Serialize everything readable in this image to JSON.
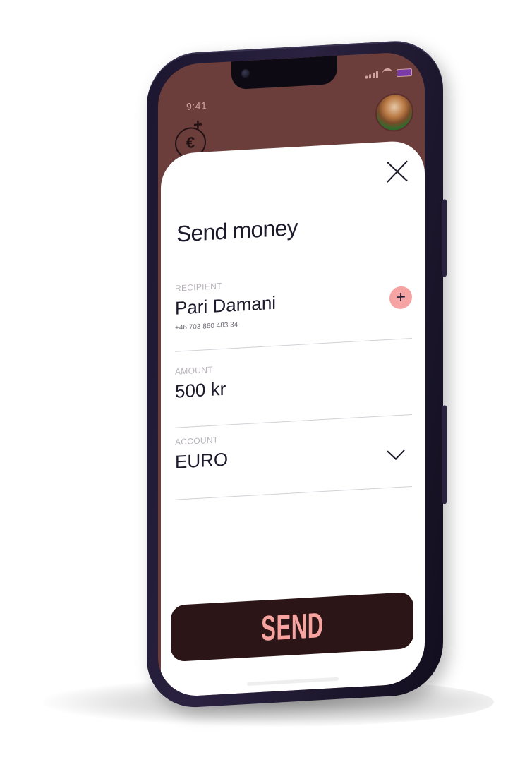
{
  "status_bar": {
    "time": "9:41"
  },
  "header": {
    "logo_icon": "euro-plus-icon",
    "logo_symbol": "€",
    "logo_plus": "+",
    "avatar_icon": "avatar"
  },
  "sheet": {
    "title": "Send money",
    "close_icon": "close-icon",
    "recipient": {
      "label": "RECIPIENT",
      "name": "Pari Damani",
      "phone": "+46 703 860 483 34",
      "add_symbol": "+"
    },
    "amount": {
      "label": "AMOUNT",
      "value": "500 kr"
    },
    "account": {
      "label": "ACCOUNT",
      "value": "EURO",
      "dropdown_icon": "chevron-down-icon"
    },
    "send_label": "SEND"
  },
  "colors": {
    "header_bg": "#6b3e3b",
    "accent_pink": "#f5a3a3",
    "button_bg": "#2c1517",
    "text_dark": "#1c1a2b"
  }
}
